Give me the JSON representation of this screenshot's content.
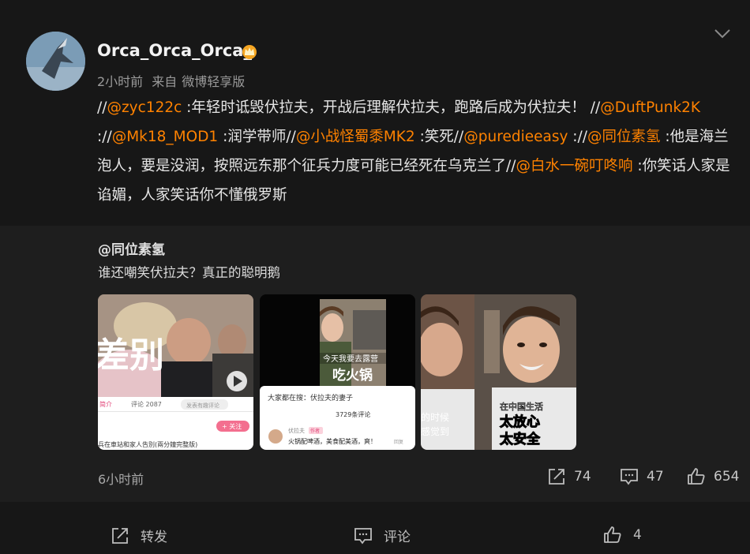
{
  "post": {
    "username": "Orca_Orca_Orca_",
    "time": "2小时前",
    "source_prefix": "来自",
    "source": "微博轻享版",
    "content": [
      {
        "type": "text",
        "text": "//"
      },
      {
        "type": "at",
        "text": "@zyc122c"
      },
      {
        "type": "text",
        "text": " :年轻时诋毁伏拉夫，开战后理解伏拉夫，跑路后成为伏拉夫！ //"
      },
      {
        "type": "at",
        "text": "@DuftPunk2K"
      },
      {
        "type": "text",
        "text": " ://"
      },
      {
        "type": "at",
        "text": "@Mk18_MOD1"
      },
      {
        "type": "text",
        "text": " :润学带师//"
      },
      {
        "type": "at",
        "text": "@小战怪蜀黍MK2"
      },
      {
        "type": "text",
        "text": " :笑死//"
      },
      {
        "type": "at",
        "text": "@puredieeasy"
      },
      {
        "type": "text",
        "text": " ://"
      },
      {
        "type": "at",
        "text": "@同位素氢"
      },
      {
        "type": "text",
        "text": " :他是海兰泡人，要是没润，按照远东那个征兵力度可能已经死在乌克兰了//"
      },
      {
        "type": "at",
        "text": "@白水一碗叮咚响"
      },
      {
        "type": "text",
        "text": " :你笑话人家是谄媚，人家笑话你不懂俄罗斯"
      }
    ]
  },
  "repost": {
    "author": "@同位素氢",
    "text": "谁还嘲笑伏拉夫？真正的聪明鹅",
    "thumbs": {
      "t1": {
        "overlay": "差别",
        "tab1": "简介",
        "tab2": "评论 2087",
        "input": "发表有趣评论",
        "follow": "+ 关注",
        "caption": "兵在車站和家人告別(兩分鐘完整版)"
      },
      "t2": {
        "banner1": "今天我要去露营",
        "banner2": "吃火锅",
        "question": "大家都在搜：伏拉夫的妻子",
        "count": "3729条评论",
        "user": "伏拉夫",
        "author_tag": "作者",
        "comment": "火锅配啤酒，美食配美酒，爽！",
        "reply": "回复"
      },
      "t3": {
        "side1": "的时候",
        "side2": "感觉到",
        "cap_small": "在中国生活",
        "cap1": "太放心",
        "cap2": "太安全"
      }
    },
    "time": "6小时前",
    "reposts": "74",
    "comments": "47",
    "likes": "654"
  },
  "actions": {
    "repost": "转发",
    "comment": "评论",
    "like": "4"
  },
  "colors": {
    "mention": "#ff8200",
    "background": "#171717",
    "repost_bg": "#1e1e1e"
  }
}
